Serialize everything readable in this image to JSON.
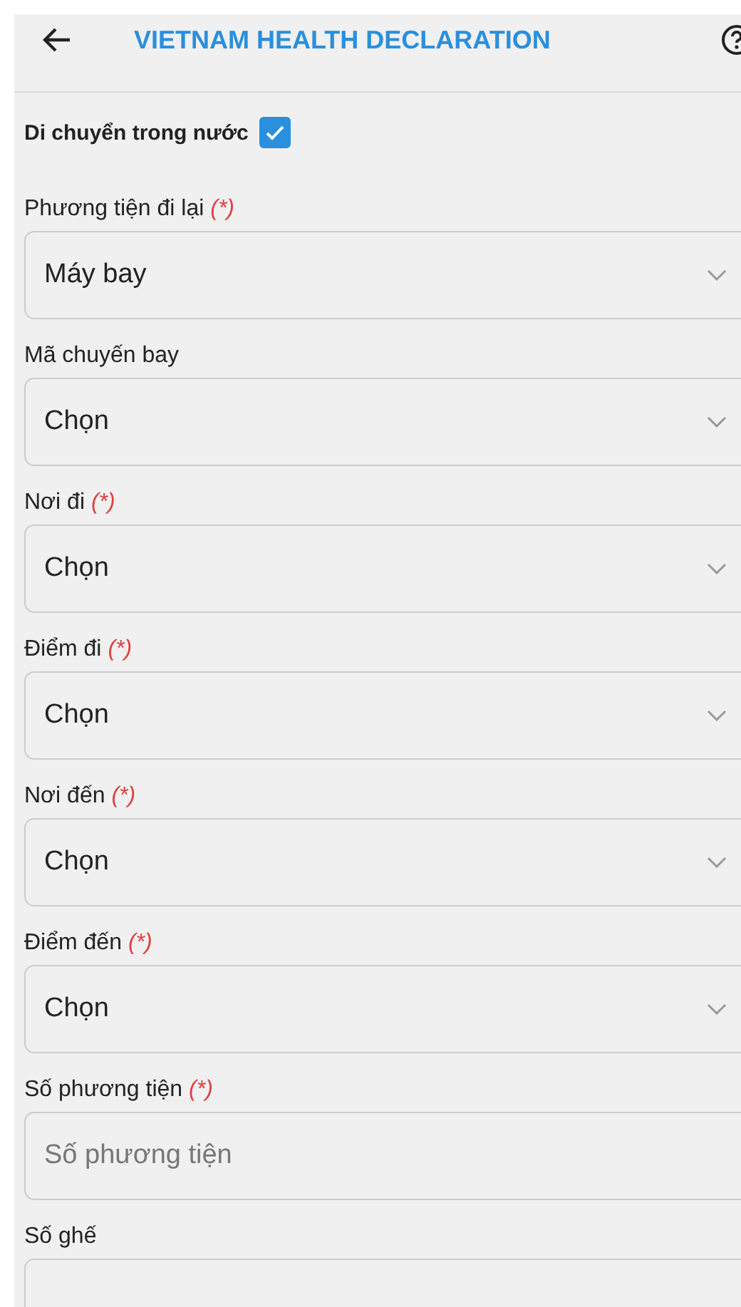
{
  "header": {
    "title": "VIETNAM HEALTH DECLARATION"
  },
  "domestic": {
    "label": "Di chuyển trong nước",
    "checked": true
  },
  "fields": [
    {
      "label": "Phương tiện đi lại",
      "required_mark": "(*)",
      "kind": "select",
      "value": "Máy bay"
    },
    {
      "label": "Mã chuyến bay",
      "kind": "select",
      "value": "Chọn"
    },
    {
      "label": "Nơi đi",
      "required_mark": "(*)",
      "kind": "select",
      "value": "Chọn"
    },
    {
      "label": "Điểm đi",
      "required_mark": "(*)",
      "kind": "select",
      "value": "Chọn"
    },
    {
      "label": "Nơi đến",
      "required_mark": "(*)",
      "kind": "select",
      "value": "Chọn"
    },
    {
      "label": "Điểm đến",
      "required_mark": "(*)",
      "kind": "select",
      "value": "Chọn"
    },
    {
      "label": "Số phương tiện",
      "required_mark": "(*)",
      "kind": "text",
      "placeholder": "Số phương tiện"
    },
    {
      "label": "Số ghế",
      "kind": "text"
    }
  ]
}
